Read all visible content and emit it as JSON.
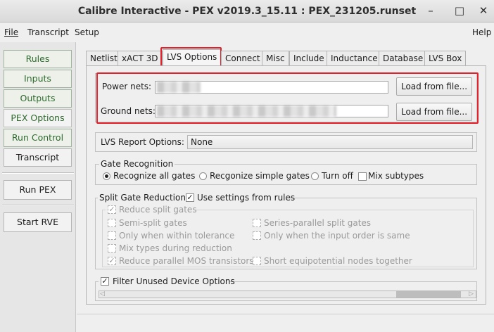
{
  "window": {
    "title": "Calibre Interactive - PEX v2019.3_15.11 : PEX_231205.runset",
    "controls": [
      "–",
      "□",
      "✕"
    ]
  },
  "menubar": {
    "file": "File",
    "transcript": "Transcript",
    "setup": "Setup",
    "help": "Help"
  },
  "nav": {
    "rules": "Rules",
    "inputs": "Inputs",
    "outputs": "Outputs",
    "pex_options": "PEX Options",
    "run_control": "Run Control",
    "transcript": "Transcript",
    "run_pex": "Run PEX",
    "start_rve": "Start RVE"
  },
  "tabs": [
    "Netlist",
    "xACT 3D",
    "LVS Options",
    "Connect",
    "Misc",
    "Include",
    "Inductance",
    "Database",
    "LVS Box"
  ],
  "nets": {
    "power_label": "Power nets:",
    "ground_label": "Ground nets:",
    "load_label": "Load from file...",
    "power_value": "",
    "ground_value": ""
  },
  "lvs_report": {
    "label": "LVS Report Options:",
    "value": "None"
  },
  "gate_recognition": {
    "title": "Gate Recognition",
    "all": "Recognize all gates",
    "simple": "Recgonize simple gates",
    "off": "Turn off",
    "mix": "Mix subtypes"
  },
  "split_gate": {
    "title": "Split Gate Reduction:",
    "use_rules": "Use settings from rules",
    "reduce": "Reduce split gates",
    "semi": "Semi-split gates",
    "series_parallel": "Series-parallel split gates",
    "tolerance": "Only when within tolerance",
    "input_order": "Only when the input order is same",
    "mix_types": "Mix types during reduction",
    "reduce_parallel": "Reduce parallel MOS transistors",
    "short_equi": "Short equipotential nodes together"
  },
  "filter": {
    "label": "Filter Unused Device Options"
  },
  "colors": {
    "highlight": "#e5202a",
    "nav_text": "#2d6a2d"
  }
}
